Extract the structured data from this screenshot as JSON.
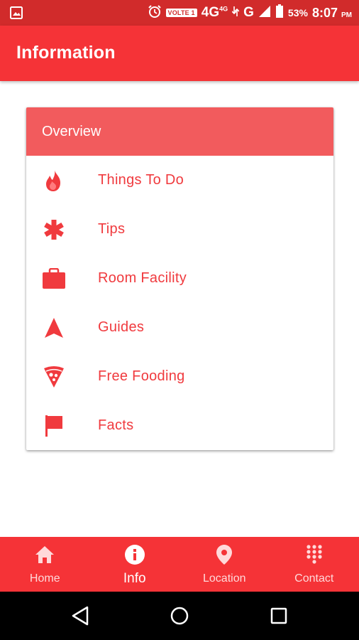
{
  "status_bar": {
    "volte": "VOLTE 1",
    "network_primary": "4G",
    "network_small": "4G",
    "network_secondary": "G",
    "battery_percent": "53%",
    "time": "8:07",
    "time_suffix": "PM",
    "icons": [
      "image-icon",
      "alarm-icon",
      "signal-icon",
      "battery-icon"
    ]
  },
  "app_bar": {
    "title": "Information"
  },
  "overview": {
    "header": "Overview",
    "items": [
      {
        "label": "Things To Do",
        "icon": "flame-icon"
      },
      {
        "label": "Tips",
        "icon": "asterisk-icon"
      },
      {
        "label": "Room Facility",
        "icon": "briefcase-icon"
      },
      {
        "label": "Guides",
        "icon": "navigation-arrow-icon"
      },
      {
        "label": "Free Fooding",
        "icon": "pizza-icon"
      },
      {
        "label": "Facts",
        "icon": "flag-icon"
      }
    ]
  },
  "bottom_nav": {
    "items": [
      {
        "label": "Home",
        "icon": "home-icon",
        "active": false
      },
      {
        "label": "Info",
        "icon": "info-icon",
        "active": true
      },
      {
        "label": "Location",
        "icon": "location-pin-icon",
        "active": false
      },
      {
        "label": "Contact",
        "icon": "dialpad-icon",
        "active": false
      }
    ]
  },
  "system_nav": {
    "buttons": [
      "back-icon",
      "home-circle-icon",
      "recents-icon"
    ]
  },
  "colors": {
    "status_bar": "#d12b2b",
    "primary": "#f53337",
    "card_header": "#f25b5d",
    "accent_text": "#f03a3e",
    "system_nav": "#000000"
  }
}
